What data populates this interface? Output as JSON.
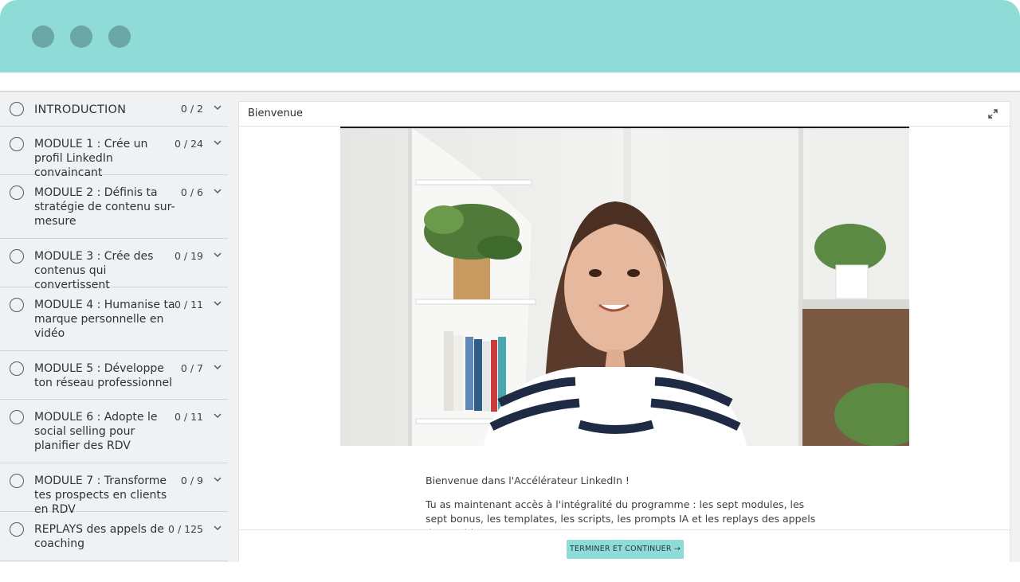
{
  "window": {
    "controls": [
      "close",
      "minimize",
      "maximize"
    ]
  },
  "sidebar": {
    "modules": [
      {
        "title": "INTRODUCTION",
        "count": "0 / 2"
      },
      {
        "title": "MODULE 1 : Crée un profil LinkedIn convaincant",
        "count": "0 / 24"
      },
      {
        "title": "MODULE 2 : Définis ta stratégie de contenu sur-mesure",
        "count": "0 / 6"
      },
      {
        "title": "MODULE 3 : Crée des contenus qui convertissent",
        "count": "0 / 19"
      },
      {
        "title": "MODULE 4 : Humanise ta marque personnelle en vidéo",
        "count": "0 / 11"
      },
      {
        "title": "MODULE 5 : Développe ton réseau professionnel",
        "count": "0 / 7"
      },
      {
        "title": "MODULE 6 : Adopte le social selling pour planifier des RDV",
        "count": "0 / 11"
      },
      {
        "title": "MODULE 7 : Transforme tes prospects en clients en RDV",
        "count": "0 / 9"
      },
      {
        "title": "REPLAYS des appels de coaching",
        "count": "0 / 125"
      }
    ]
  },
  "lesson": {
    "title": "Bienvenue",
    "intro": "Bienvenue dans l'Accélérateur LinkedIn !",
    "body": "Tu as maintenant accès à l'intégralité du programme : les sept modules, les sept bonus, les templates, les scripts, les prompts IA et les replays des appels de coaching.",
    "cta_label": "TERMINER ET CONTINUER →"
  },
  "colors": {
    "accent": "#8fdbd7",
    "sidebar_bg": "#f0f1f2"
  },
  "icons": {
    "expand": "expand-icon",
    "chevron": "chevron-down-icon",
    "status": "circle-icon"
  }
}
